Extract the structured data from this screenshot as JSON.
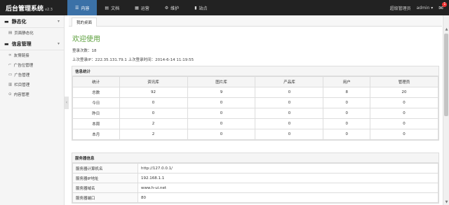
{
  "app": {
    "name": "后台管理系统",
    "version": "v2.3"
  },
  "nav": [
    {
      "icon": "list-icon",
      "label": "内容"
    },
    {
      "icon": "file-icon",
      "label": "文档"
    },
    {
      "icon": "calendar-icon",
      "label": "运营"
    },
    {
      "icon": "gear-icon",
      "label": "维护"
    },
    {
      "icon": "chart-icon",
      "label": "站点"
    }
  ],
  "user": {
    "role": "超级管理员",
    "name": "admin ▾",
    "mail_count": "1",
    "mail_icon": "mail-icon"
  },
  "sidebar": {
    "groups": [
      {
        "title": "静态化",
        "icon": "book-icon",
        "items": [
          {
            "label": "页面静态化",
            "icon": "page-icon"
          }
        ]
      },
      {
        "title": "信息管理",
        "icon": "info-icon",
        "items": [
          {
            "label": "友情链接",
            "icon": "link-icon"
          },
          {
            "label": "广告位管理",
            "icon": "ad-slot-icon"
          },
          {
            "label": "广告管理",
            "icon": "ad-icon"
          },
          {
            "label": "栏目管理",
            "icon": "column-icon"
          },
          {
            "label": "内容管理",
            "icon": "content-icon"
          }
        ]
      }
    ]
  },
  "tabs": [
    "我的桌面"
  ],
  "main": {
    "welcome": "欢迎使用",
    "login_count": "登录次数：18",
    "last_login": "上次登录IP：222.35.131.79.1  上次登录时间：2014-6-14 11:19:55"
  },
  "stats": {
    "title": "信息统计",
    "columns": [
      "统计",
      "资讯库",
      "图片库",
      "产品库",
      "用户",
      "管理员"
    ],
    "rows": [
      [
        "总数",
        "92",
        "9",
        "0",
        "8",
        "20"
      ],
      [
        "今日",
        "0",
        "0",
        "0",
        "0",
        "0"
      ],
      [
        "昨日",
        "0",
        "0",
        "0",
        "0",
        "0"
      ],
      [
        "本周",
        "2",
        "0",
        "0",
        "0",
        "0"
      ],
      [
        "本月",
        "2",
        "0",
        "0",
        "0",
        "0"
      ]
    ]
  },
  "server": {
    "title": "服务器信息",
    "rows": [
      [
        "服务器计算机名",
        "http://127.0.0.1/"
      ],
      [
        "服务器IP地址",
        "192.168.1.1"
      ],
      [
        "服务器域名",
        "www.h-ui.net"
      ],
      [
        "服务器端口",
        "80"
      ]
    ]
  },
  "colors": {
    "topbar": "#222222",
    "nav_active": "#3b71a7",
    "welcome": "#5a9e3a"
  }
}
